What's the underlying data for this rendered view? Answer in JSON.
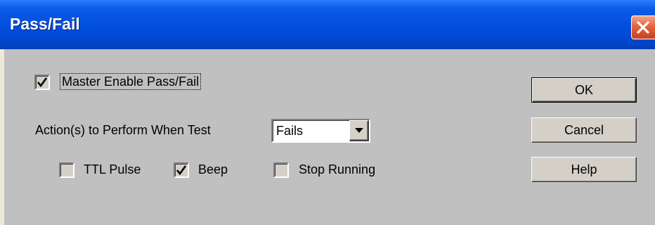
{
  "window": {
    "title": "Pass/Fail"
  },
  "master_enable": {
    "label": "Master Enable Pass/Fail",
    "checked": true
  },
  "action": {
    "label": "Action(s) to Perform When Test",
    "selected": "Fails"
  },
  "options": {
    "ttl_pulse": {
      "label": "TTL Pulse",
      "checked": false
    },
    "beep": {
      "label": "Beep",
      "checked": true
    },
    "stop_running": {
      "label": "Stop Running",
      "checked": false
    }
  },
  "buttons": {
    "ok": "OK",
    "cancel": "Cancel",
    "help": "Help"
  },
  "colors": {
    "titlebar": "#0451df",
    "dialog_face": "#c0c0c0",
    "close_button": "#e2643f"
  }
}
